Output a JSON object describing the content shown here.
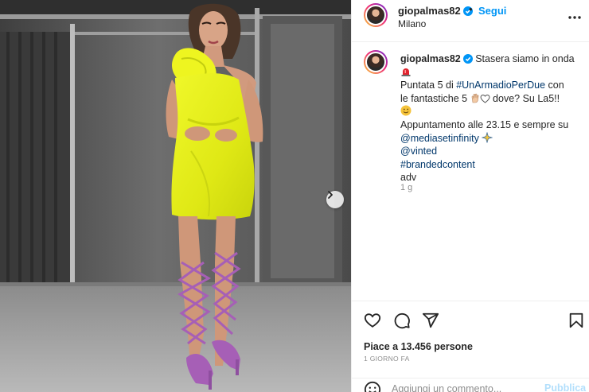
{
  "post": {
    "username": "giopalmas82",
    "follow_label": "Segui",
    "separator": "•",
    "location": "Milano",
    "caption": {
      "username": "giopalmas82",
      "line1": "Stasera siamo in onda",
      "line2_prefix": "Puntata 5 di ",
      "hashtag_show": "#UnArmadioPerDue",
      "line2_suffix": " con",
      "line3_prefix": "le fantastiche 5 ",
      "line3_suffix": " dove? Su La5!!",
      "line4": "Appuntamento alle 23.15 e sempre su",
      "mention_1": "@mediasetinfinity",
      "mention_2": "@vinted",
      "hashtag_branded": "#brandedcontent",
      "line_adv": "adv"
    },
    "age": "1 g",
    "likes": "Piace a 13.456 persone",
    "date": "1 GIORNO FA",
    "comment_placeholder": "Aggiungi un commento...",
    "publish_label": "Pubblica"
  },
  "icons": {
    "verified": "verified-badge-icon",
    "more": "more-options-icon",
    "siren": "siren-emoji-icon",
    "hand": "hand-emoji-icon",
    "heart": "heart-emoji-icon",
    "smile": "smile-emoji-icon",
    "sparkles": "sparkles-emoji-icon",
    "like": "heart-icon",
    "comment": "comment-icon",
    "share": "share-icon",
    "save": "bookmark-icon",
    "emoji": "emoji-icon",
    "next": "chevron-right-icon"
  },
  "colors": {
    "accent_blue": "#0095f6",
    "link_blue": "#00376b",
    "verified_blue": "#0095f6",
    "muted_text": "#8e8e8e",
    "dress_yellow": "#e4f218",
    "sandal_purple": "#a65fb6"
  }
}
